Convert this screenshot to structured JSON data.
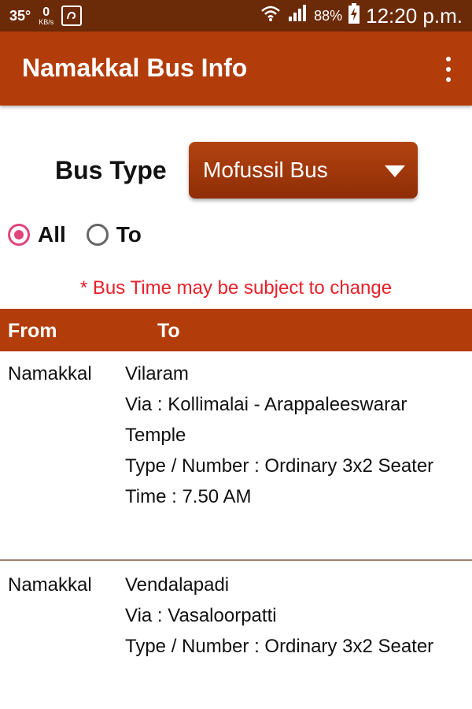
{
  "status_bar": {
    "temperature": "35°",
    "speed_value": "0",
    "speed_unit": "KB/s",
    "battery_percent": "88%",
    "time": "12:20 p.m.",
    "icons": [
      "wifi-icon",
      "signal-icon",
      "battery-charging-icon",
      "app-notification-icon"
    ]
  },
  "app_bar": {
    "title": "Namakkal Bus Info"
  },
  "bus_type": {
    "label": "Bus Type",
    "selected": "Mofussil Bus"
  },
  "filters": {
    "options": [
      {
        "label": "All",
        "checked": true
      },
      {
        "label": "To",
        "checked": false
      }
    ]
  },
  "notice": "* Bus Time may be subject to change",
  "table": {
    "headers": {
      "from": "From",
      "to": "To"
    },
    "rows": [
      {
        "from": "Namakkal",
        "to": "Vilaram",
        "via": "Via : Kollimalai - Arappaleeswarar Temple",
        "type_number": "Type / Number :  Ordinary 3x2 Seater",
        "time": "Time : 7.50 AM"
      },
      {
        "from": "Namakkal",
        "to": "Vendalapadi",
        "via": "Via : Vasaloorpatti",
        "type_number": "Type / Number :  Ordinary 3x2 Seater"
      }
    ]
  },
  "colors": {
    "status_bar": "#6b2a08",
    "primary": "#b23c0a",
    "radio_accent": "#e0457a",
    "notice": "#e8202a"
  }
}
